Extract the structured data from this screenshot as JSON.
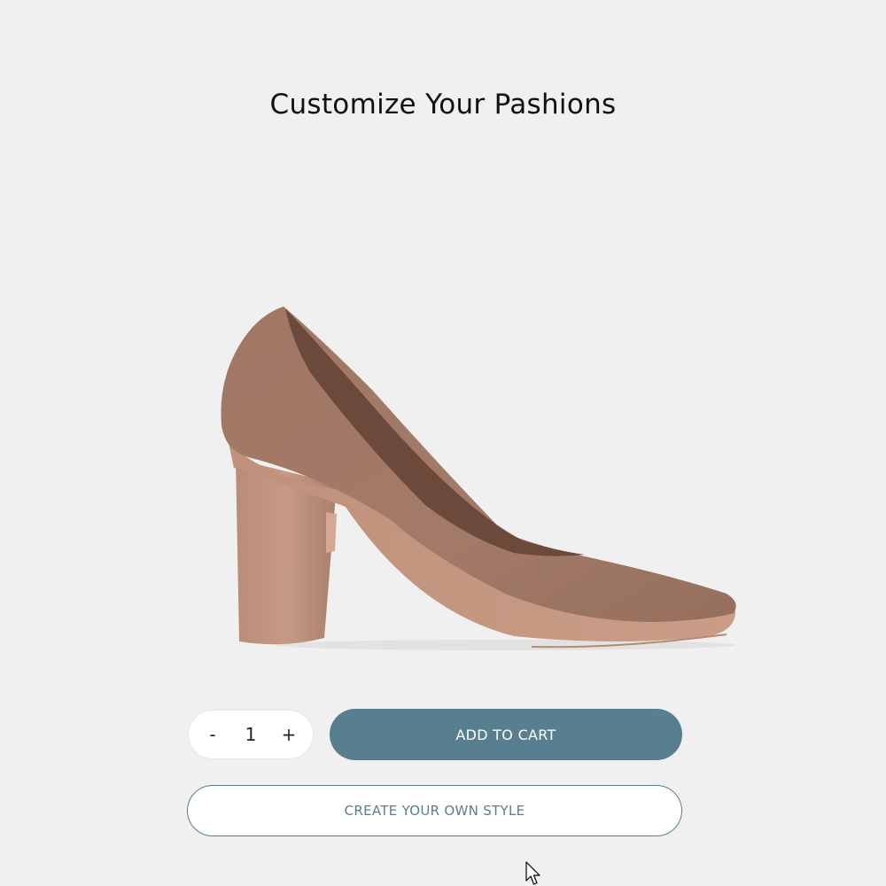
{
  "header": {
    "title": "Customize Your Pashions"
  },
  "product": {
    "image_icon": "pump-heel-shoe",
    "color": "#a37a67"
  },
  "quantity": {
    "decrement_label": "-",
    "value": "1",
    "increment_label": "+"
  },
  "actions": {
    "add_to_cart_label": "ADD TO CART",
    "create_style_label": "CREATE YOUR OWN STYLE"
  },
  "colors": {
    "accent": "#587f8f",
    "background": "#f0f0f0"
  }
}
